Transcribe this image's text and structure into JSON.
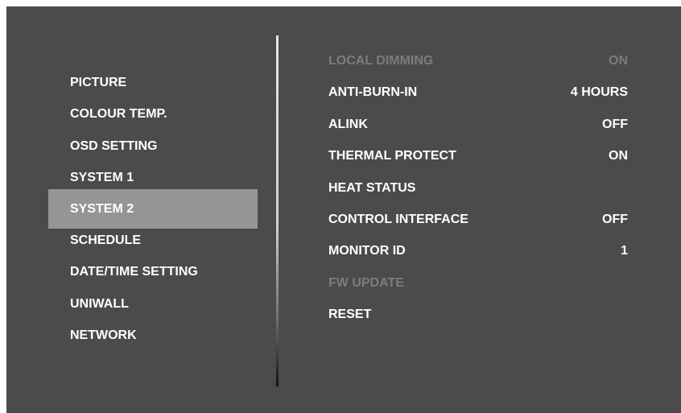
{
  "left_menu": {
    "items": [
      {
        "label": "PICTURE",
        "selected": false
      },
      {
        "label": "COLOUR TEMP.",
        "selected": false
      },
      {
        "label": "OSD SETTING",
        "selected": false
      },
      {
        "label": "SYSTEM 1",
        "selected": false
      },
      {
        "label": "SYSTEM 2",
        "selected": true
      },
      {
        "label": "SCHEDULE",
        "selected": false
      },
      {
        "label": "DATE/TIME SETTING",
        "selected": false
      },
      {
        "label": "UNIWALL",
        "selected": false
      },
      {
        "label": "NETWORK",
        "selected": false
      }
    ]
  },
  "settings": {
    "rows": [
      {
        "label": "LOCAL DIMMING",
        "value": "ON",
        "enabled": false
      },
      {
        "label": "ANTI-BURN-IN",
        "value": "4 HOURS",
        "enabled": true
      },
      {
        "label": "ALINK",
        "value": "OFF",
        "enabled": true
      },
      {
        "label": "THERMAL PROTECT",
        "value": "ON",
        "enabled": true
      },
      {
        "label": "HEAT STATUS",
        "value": "",
        "enabled": true
      },
      {
        "label": "CONTROL INTERFACE",
        "value": "OFF",
        "enabled": true
      },
      {
        "label": "MONITOR ID",
        "value": "1",
        "enabled": true
      },
      {
        "label": "FW UPDATE",
        "value": "",
        "enabled": false
      },
      {
        "label": "RESET",
        "value": "",
        "enabled": true
      }
    ]
  },
  "colors": {
    "panel_background": "#4b4b4b",
    "selected_highlight": "#959595",
    "text": "#ffffff",
    "disabled_text": "#7c7c7c"
  }
}
